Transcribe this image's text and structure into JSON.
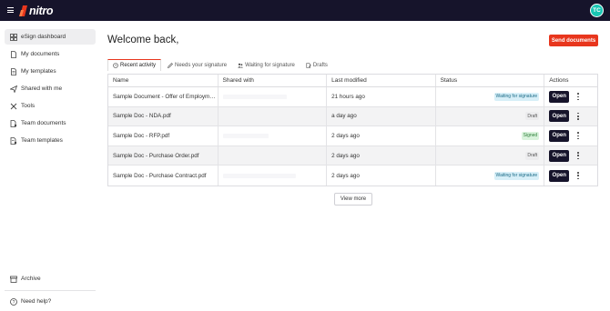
{
  "header": {
    "logo_text": "nitro",
    "avatar_initials": "TC",
    "brand_color": "#e8361d"
  },
  "sidebar": {
    "items": [
      {
        "label": "eSign dashboard",
        "icon": "grid-icon"
      },
      {
        "label": "My documents",
        "icon": "document-icon"
      },
      {
        "label": "My templates",
        "icon": "template-icon"
      },
      {
        "label": "Shared with me",
        "icon": "send-icon"
      },
      {
        "label": "Tools",
        "icon": "tools-icon"
      },
      {
        "label": "Team documents",
        "icon": "team-document-icon"
      },
      {
        "label": "Team templates",
        "icon": "team-template-icon"
      }
    ],
    "archive_label": "Archive",
    "help_label": "Need help?"
  },
  "main": {
    "welcome": "Welcome back,",
    "send_button": "Send documents",
    "tabs": [
      {
        "label": "Recent activity",
        "icon": "clock-icon"
      },
      {
        "label": "Needs your signature",
        "icon": "pen-icon"
      },
      {
        "label": "Waiting for signature",
        "icon": "people-icon"
      },
      {
        "label": "Drafts",
        "icon": "draft-icon"
      }
    ],
    "table": {
      "columns": [
        "Name",
        "Shared with",
        "Last modified",
        "Status",
        "Actions"
      ],
      "rows": [
        {
          "name": "Sample Document - Offer of Employm…",
          "modified": "21 hours ago",
          "status": "Waiting for signature",
          "status_type": "waiting",
          "action": "Open"
        },
        {
          "name": "Sample Doc - NDA.pdf",
          "modified": "a day ago",
          "status": "Draft",
          "status_type": "draft",
          "action": "Open"
        },
        {
          "name": "Sample Doc - RFP.pdf",
          "modified": "2 days ago",
          "status": "Signed",
          "status_type": "signed",
          "action": "Open"
        },
        {
          "name": "Sample Doc - Purchase Order.pdf",
          "modified": "2 days ago",
          "status": "Draft",
          "status_type": "draft",
          "action": "Open"
        },
        {
          "name": "Sample Doc - Purchase Contract.pdf",
          "modified": "2 days ago",
          "status": "Waiting for signature",
          "status_type": "waiting",
          "action": "Open"
        }
      ]
    },
    "view_more": "View more"
  }
}
